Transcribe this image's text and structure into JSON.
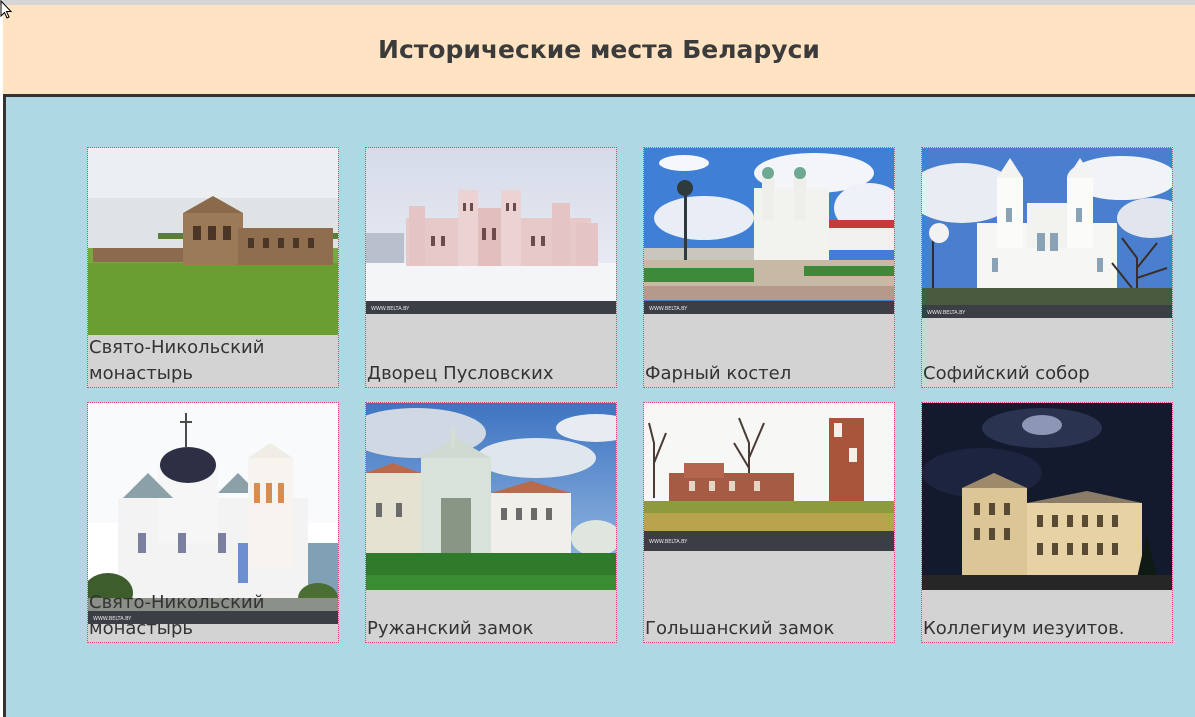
{
  "header": {
    "title": "Исторические места Беларуси"
  },
  "places": [
    {
      "name": "Свято-Никольский монастырь",
      "photo": "ruzhany-palace-ruins-on-lawn"
    },
    {
      "name": "Дворец Пусловских",
      "photo": "kossovo-castle-in-snow"
    },
    {
      "name": "Фарный костел",
      "photo": "farny-church-square"
    },
    {
      "name": "Софийский собор",
      "photo": "st-sophia-cathedral-towers"
    },
    {
      "name": "Свято-Никольский монастырь",
      "photo": "st-nicholas-monastery-white-church"
    },
    {
      "name": "Ружанский замок",
      "photo": "ruzhany-castle-gate"
    },
    {
      "name": "Гольшанский замок",
      "photo": "golshany-castle-ruins"
    },
    {
      "name": "Коллегиум иезуитов.",
      "photo": "jesuit-college-at-night"
    }
  ],
  "watermark": "WWW.BELTA.BY"
}
